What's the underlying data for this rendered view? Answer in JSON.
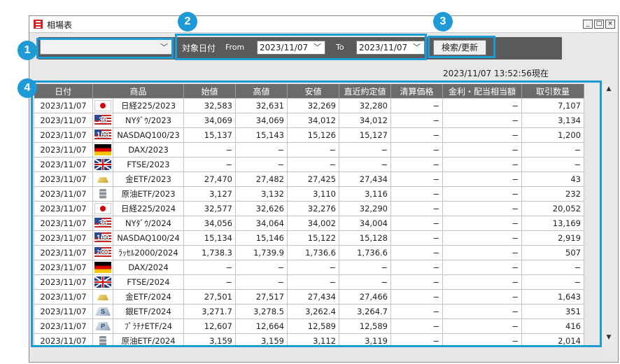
{
  "window": {
    "title": "相場表",
    "min": "_",
    "max": "□",
    "close": "×"
  },
  "toolbar": {
    "combo_value": "",
    "date_label": "対象日付",
    "from_label": "From",
    "from_value": "2023/11/07",
    "to_label": "To",
    "to_value": "2023/11/07",
    "search_label": "検索/更新"
  },
  "timestamp": "2023/11/07 13:52:56現在",
  "callouts": [
    "1",
    "2",
    "3",
    "4"
  ],
  "columns": [
    "日付",
    "商品",
    "始値",
    "高値",
    "安値",
    "直近約定値",
    "清算価格",
    "金利・配当相当額",
    "取引数量"
  ],
  "rows": [
    {
      "date": "2023/11/07",
      "flag": "jp",
      "badge": "",
      "product": "日経225/2023",
      "open": "32,583",
      "high": "32,631",
      "low": "32,269",
      "last": "32,280",
      "settle": "−",
      "interest": "−",
      "volume": "7,107"
    },
    {
      "date": "2023/11/07",
      "flag": "us",
      "badge": "30",
      "product": "NYﾀﾞｳ/2023",
      "open": "34,069",
      "high": "34,069",
      "low": "34,012",
      "last": "34,012",
      "settle": "−",
      "interest": "−",
      "volume": "3,134"
    },
    {
      "date": "2023/11/07",
      "flag": "us",
      "badge": "100",
      "product": "NASDAQ100/23",
      "open": "15,137",
      "high": "15,143",
      "low": "15,126",
      "last": "15,127",
      "settle": "−",
      "interest": "−",
      "volume": "1,200"
    },
    {
      "date": "2023/11/07",
      "flag": "de",
      "badge": "",
      "product": "DAX/2023",
      "open": "−",
      "high": "−",
      "low": "−",
      "last": "−",
      "settle": "−",
      "interest": "−",
      "volume": "−"
    },
    {
      "date": "2023/11/07",
      "flag": "uk",
      "badge": "",
      "product": "FTSE/2023",
      "open": "−",
      "high": "−",
      "low": "−",
      "last": "−",
      "settle": "−",
      "interest": "−",
      "volume": "−"
    },
    {
      "date": "2023/11/07",
      "flag": "gold",
      "badge": "",
      "product": "金ETF/2023",
      "open": "27,470",
      "high": "27,482",
      "low": "27,425",
      "last": "27,434",
      "settle": "−",
      "interest": "−",
      "volume": "43"
    },
    {
      "date": "2023/11/07",
      "flag": "oil",
      "badge": "",
      "product": "原油ETF/2023",
      "open": "3,127",
      "high": "3,132",
      "low": "3,110",
      "last": "3,116",
      "settle": "−",
      "interest": "−",
      "volume": "232"
    },
    {
      "date": "2023/11/07",
      "flag": "jp",
      "badge": "",
      "product": "日経225/2024",
      "open": "32,577",
      "high": "32,626",
      "low": "32,276",
      "last": "32,290",
      "settle": "−",
      "interest": "−",
      "volume": "20,052"
    },
    {
      "date": "2023/11/07",
      "flag": "us",
      "badge": "30",
      "product": "NYﾀﾞｳ/2024",
      "open": "34,056",
      "high": "34,064",
      "low": "34,002",
      "last": "34,004",
      "settle": "−",
      "interest": "−",
      "volume": "13,169"
    },
    {
      "date": "2023/11/07",
      "flag": "us",
      "badge": "100",
      "product": "NASDAQ100/24",
      "open": "15,134",
      "high": "15,146",
      "low": "15,122",
      "last": "15,128",
      "settle": "−",
      "interest": "−",
      "volume": "2,919"
    },
    {
      "date": "2023/11/07",
      "flag": "us",
      "badge": "2000",
      "product": "ﾗｯｾﾙ2000/2024",
      "open": "1,738.3",
      "high": "1,739.9",
      "low": "1,736.6",
      "last": "1,736.6",
      "settle": "−",
      "interest": "−",
      "volume": "507"
    },
    {
      "date": "2023/11/07",
      "flag": "de",
      "badge": "",
      "product": "DAX/2024",
      "open": "−",
      "high": "−",
      "low": "−",
      "last": "−",
      "settle": "−",
      "interest": "−",
      "volume": "−"
    },
    {
      "date": "2023/11/07",
      "flag": "uk",
      "badge": "",
      "product": "FTSE/2024",
      "open": "−",
      "high": "−",
      "low": "−",
      "last": "−",
      "settle": "−",
      "interest": "−",
      "volume": "−"
    },
    {
      "date": "2023/11/07",
      "flag": "gold",
      "badge": "",
      "product": "金ETF/2024",
      "open": "27,501",
      "high": "27,517",
      "low": "27,434",
      "last": "27,466",
      "settle": "−",
      "interest": "−",
      "volume": "1,643"
    },
    {
      "date": "2023/11/07",
      "flag": "metal",
      "badge": "S",
      "product": "銀ETF/2024",
      "open": "3,271.7",
      "high": "3,278.5",
      "low": "3,262.4",
      "last": "3,264.7",
      "settle": "−",
      "interest": "−",
      "volume": "351"
    },
    {
      "date": "2023/11/07",
      "flag": "metal",
      "badge": "P",
      "product": "ﾌﾟﾗﾁﾅETF/24",
      "open": "12,607",
      "high": "12,664",
      "low": "12,589",
      "last": "12,589",
      "settle": "−",
      "interest": "−",
      "volume": "416"
    },
    {
      "date": "2023/11/07",
      "flag": "oil",
      "badge": "",
      "product": "原油ETF/2024",
      "open": "3,159",
      "high": "3,159",
      "low": "3,112",
      "last": "3,119",
      "settle": "−",
      "interest": "−",
      "volume": "2,014"
    }
  ],
  "colors": {
    "callout": "#1e9ad6",
    "toolbar": "#5a5a5a",
    "header": "#6b6b6b"
  }
}
